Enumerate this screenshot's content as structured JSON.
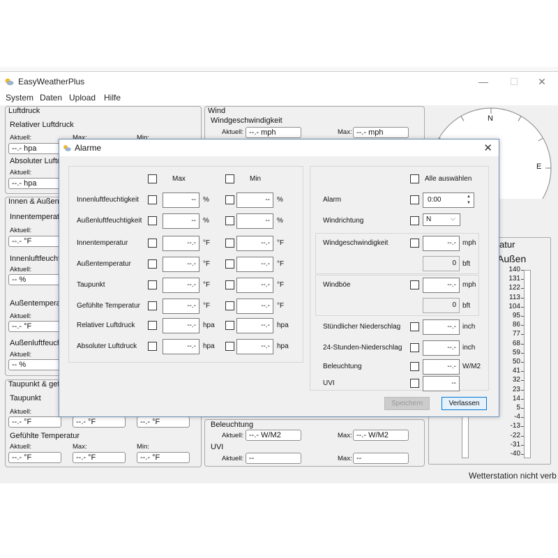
{
  "app": {
    "title": "EasyWeatherPlus",
    "menu": [
      "System",
      "Daten",
      "Upload",
      "Hilfe"
    ],
    "status": "Wetterstation nicht verb"
  },
  "luftdruck": {
    "header": "Luftdruck",
    "rel_label": "Relativer Luftdruck",
    "aktuell": "Aktuell:",
    "max": "Max:",
    "min": "Min:",
    "rel_value": "--.- hpa",
    "abs_label": "Absoluter Luftd",
    "abs_aktuell": "Aktuell:",
    "abs_value": "--.- hpa"
  },
  "innen": {
    "header": "Innen & Außen",
    "it_label": "Innentemperat",
    "it_aktuell": "Aktuell:",
    "it_value": "--.- °F",
    "ih_label": "Innenluftfeucht",
    "ih_aktuell": "Aktuell:",
    "ih_value": "-- %",
    "at_label": "Außentempera",
    "at_aktuell": "Aktuell:",
    "at_value": "--.- °F",
    "ah_label": "Außenluftfeuch",
    "ah_aktuell": "Aktuell:",
    "ah_value": "-- %"
  },
  "taupunkt": {
    "header": "Taupunkt & gef",
    "tp_label": "Taupunkt",
    "tp_aktuell": "Aktuell:",
    "tp_v1": "--.- °F",
    "tp_v2": "--.- °F",
    "tp_v3": "--.- °F",
    "gt_label": "Gefühlte Temperatur",
    "gt_aktuell": "Aktuell:",
    "gt_max": "Max:",
    "gt_min": "Min:",
    "gt_v1": "--.- °F",
    "gt_v2": "--.- °F",
    "gt_v3": "--.- °F"
  },
  "wind": {
    "header": "Wind",
    "ws_label": "Windgeschwindigkeit",
    "aktuell": "Aktuell:",
    "max": "Max:",
    "ws_value": "--.- mph",
    "ws_max": "--.- mph"
  },
  "beleuchtung": {
    "label": "Beleuchtung",
    "aktuell": "Aktuell:",
    "max": "Max:",
    "value": "--.- W/M2",
    "max_value": "--.- W/M2"
  },
  "uvi": {
    "label": "UVI",
    "aktuell": "Aktuell:",
    "max": "Max:",
    "value": "--",
    "max_value": "--"
  },
  "compass": {
    "n": "N",
    "e": "E"
  },
  "thermo": {
    "title_part": "atur",
    "col": "Außen",
    "ticks": [
      "140",
      "131",
      "122",
      "113",
      "104",
      "95",
      "86",
      "77",
      "68",
      "59",
      "50",
      "41",
      "32",
      "23",
      "14",
      "5",
      "-4",
      "-13",
      "-22",
      "-31",
      "-40"
    ]
  },
  "dialog": {
    "title": "Alarme",
    "max": "Max",
    "min": "Min",
    "rows": [
      {
        "label": "Innenluftfeuchtigkeit",
        "max": "--",
        "min": "--",
        "unit": "%"
      },
      {
        "label": "Außenluftfeuchtigkeit",
        "max": "--",
        "min": "--",
        "unit": "%"
      },
      {
        "label": "Innentemperatur",
        "max": "--.-",
        "min": "--.-",
        "unit": "°F"
      },
      {
        "label": "Außentemperatur",
        "max": "--.-",
        "min": "--.-",
        "unit": "°F"
      },
      {
        "label": "Taupunkt",
        "max": "--.-",
        "min": "--.-",
        "unit": "°F"
      },
      {
        "label": "Gefühlte Temperatur",
        "max": "--.-",
        "min": "--.-",
        "unit": "°F"
      },
      {
        "label": "Relativer Luftdruck",
        "max": "--.-",
        "min": "--.-",
        "unit": "hpa"
      },
      {
        "label": "Absoluter Luftdruck",
        "max": "--.-",
        "min": "--.-",
        "unit": "hpa"
      }
    ],
    "select_all": "Alle auswählen",
    "alarm": {
      "label": "Alarm",
      "value": "0:00"
    },
    "winddir": {
      "label": "Windrichtung",
      "value": "N"
    },
    "windspeed": {
      "label": "Windgeschwindigkeit",
      "value": "--.-",
      "unit": "mph",
      "bft": "0",
      "bft_unit": "bft"
    },
    "gust": {
      "label": "Windböe",
      "value": "--.-",
      "unit": "mph",
      "bft": "0",
      "bft_unit": "bft"
    },
    "rain_hour": {
      "label": "Stündlicher Niederschlag",
      "value": "--.-",
      "unit": "inch"
    },
    "rain_day": {
      "label": "24-Stunden-Niederschlag",
      "value": "--.-",
      "unit": "inch"
    },
    "light": {
      "label": "Beleuchtung",
      "value": "--.-",
      "unit": "W/M2"
    },
    "uvi": {
      "label": "UVI",
      "value": "--"
    },
    "save": "Speichern",
    "exit": "Verlassen"
  }
}
